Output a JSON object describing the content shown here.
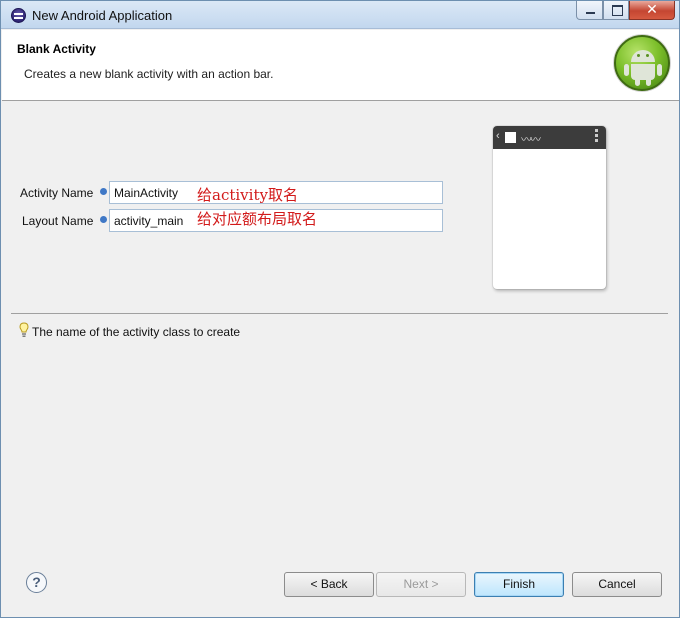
{
  "window": {
    "title": "New Android Application"
  },
  "header": {
    "title": "Blank Activity",
    "description": "Creates a new blank activity with an action bar."
  },
  "form": {
    "activity_name": {
      "label": "Activity Name",
      "value": "MainActivity",
      "annotation": "给activity取名"
    },
    "layout_name": {
      "label": "Layout Name",
      "value": "activity_main",
      "annotation": "给对应额布局取名"
    }
  },
  "hint": {
    "text": "The name of the activity class to create"
  },
  "buttons": {
    "back": "< Back",
    "next": "Next >",
    "finish": "Finish",
    "cancel": "Cancel",
    "help": "?"
  },
  "colors": {
    "annotation": "#d21a1a",
    "android_green": "#7cbf2a"
  },
  "icons": [
    "eclipse-icon",
    "android-logo-icon",
    "info-icon",
    "lightbulb-icon",
    "help-icon"
  ]
}
